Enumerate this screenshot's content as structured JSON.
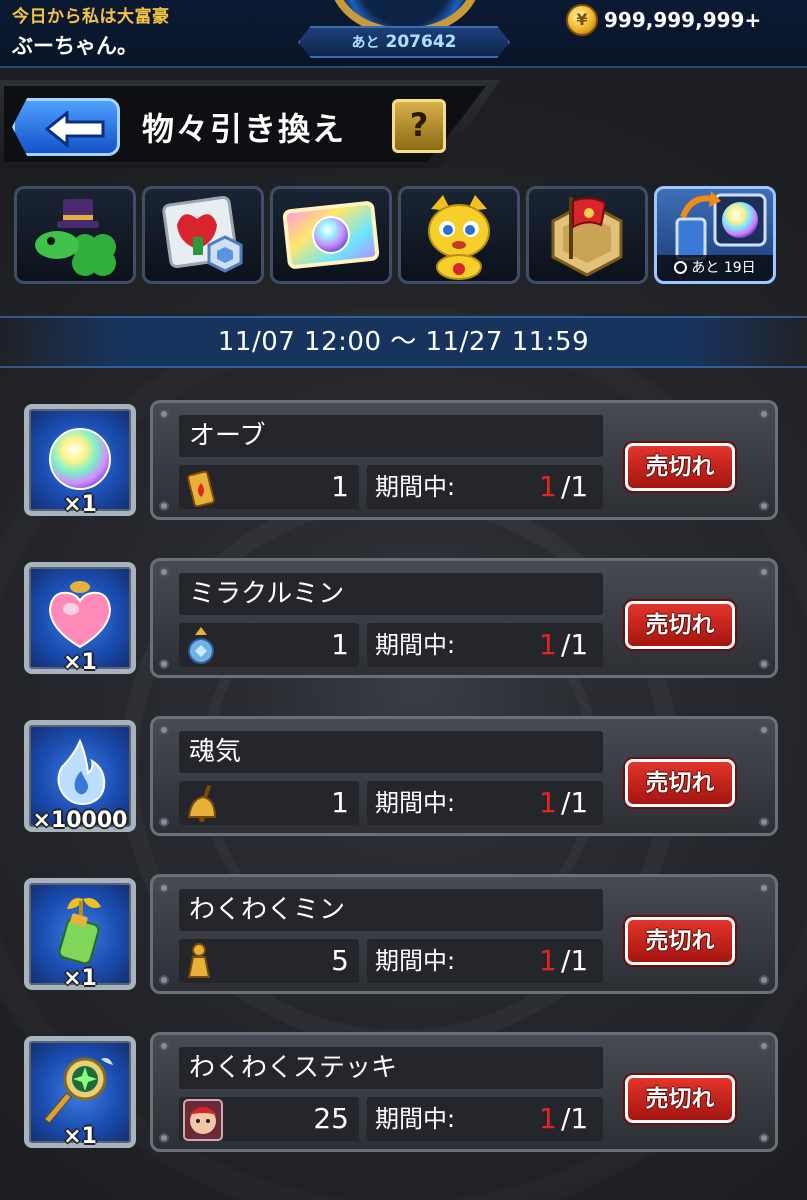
{
  "player": {
    "title": "今日から私は大富豪",
    "name": "ぶーちゃん。",
    "exp_prefix": "あと",
    "exp_remaining": "207642",
    "coins": "999,999,999+"
  },
  "header": {
    "title": "物々引き換え",
    "help_label": "?"
  },
  "tabs": [
    {
      "icon": "clover-hat-icon",
      "active": false
    },
    {
      "icon": "medal-card-icon",
      "active": false
    },
    {
      "icon": "orb-ticket-icon",
      "active": false
    },
    {
      "icon": "yellow-monster-icon",
      "active": false
    },
    {
      "icon": "flag-badge-icon",
      "active": false
    },
    {
      "icon": "orb-exchange-icon",
      "active": true,
      "badge_prefix": "あと",
      "badge_value": "19日"
    }
  ],
  "period": "11/07 12:00 〜 11/27 11:59",
  "items": [
    {
      "name": "オーブ",
      "quantity": "×1",
      "icon": "rainbow-orb-icon",
      "cost_icon": "fire-can-icon",
      "cost": "1",
      "limit_label": "期間中:",
      "limit_current": "1",
      "limit_total": "/1",
      "button": "売切れ"
    },
    {
      "name": "ミラクルミン",
      "quantity": "×1",
      "icon": "heart-potion-icon",
      "cost_icon": "blue-bottle-icon",
      "cost": "1",
      "limit_label": "期間中:",
      "limit_current": "1",
      "limit_total": "/1",
      "button": "売切れ"
    },
    {
      "name": "魂気",
      "quantity": "×10000",
      "icon": "soul-flame-icon",
      "cost_icon": "bell-icon",
      "cost": "1",
      "limit_label": "期間中:",
      "limit_current": "1",
      "limit_total": "/1",
      "button": "売切れ"
    },
    {
      "name": "わくわくミン",
      "quantity": "×1",
      "icon": "sprout-bottle-icon",
      "cost_icon": "pawn-icon",
      "cost": "5",
      "limit_label": "期間中:",
      "limit_current": "1",
      "limit_total": "/1",
      "button": "売切れ"
    },
    {
      "name": "わくわくステッキ",
      "quantity": "×1",
      "icon": "magic-wand-icon",
      "cost_icon": "character-face-icon",
      "cost": "25",
      "limit_label": "期間中:",
      "limit_current": "1",
      "limit_total": "/1",
      "button": "売切れ"
    }
  ],
  "colors": {
    "accent_blue": "#1452c8",
    "soldout_red": "#c21e17",
    "limit_red": "#e2261e",
    "gold": "#f4c542"
  }
}
